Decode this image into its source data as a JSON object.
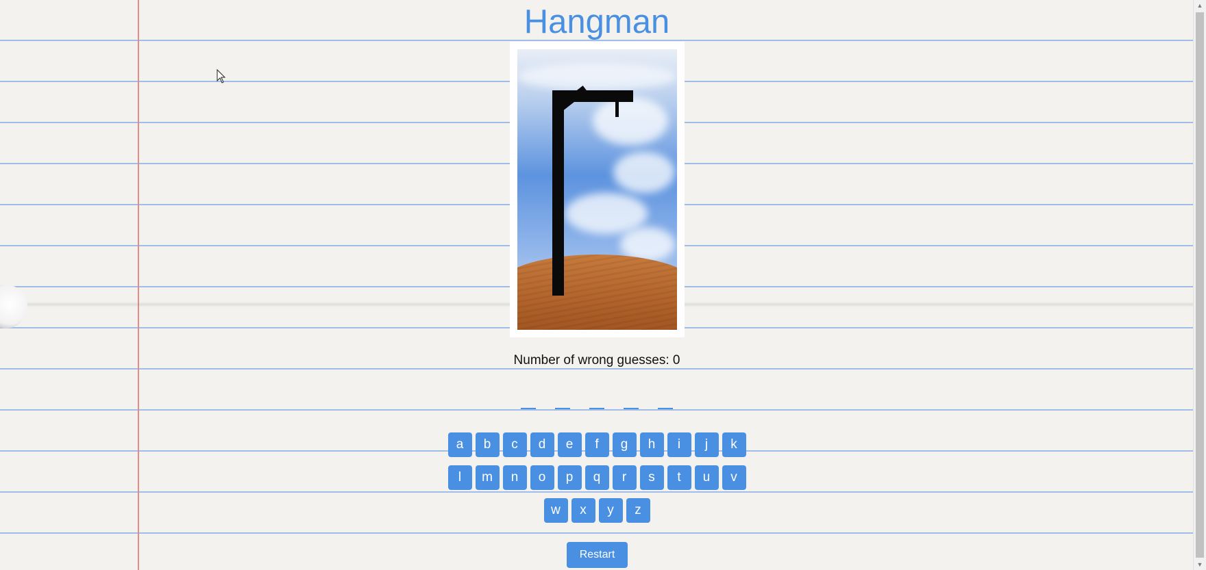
{
  "page": {
    "title": "Hangman"
  },
  "status": {
    "wrong_guesses_text": "Number of wrong guesses: 0",
    "wrong_guesses_count": 0
  },
  "word": {
    "length": 5,
    "revealed": [
      "",
      "",
      "",
      "",
      ""
    ]
  },
  "keyboard": {
    "rows": [
      [
        "a",
        "b",
        "c",
        "d",
        "e",
        "f",
        "g",
        "h",
        "i",
        "j",
        "k"
      ],
      [
        "l",
        "m",
        "n",
        "o",
        "p",
        "q",
        "r",
        "s",
        "t",
        "u",
        "v"
      ],
      [
        "w",
        "x",
        "y",
        "z"
      ]
    ]
  },
  "actions": {
    "restart_label": "Restart"
  },
  "icons": {
    "cursor": "mouse-pointer-icon",
    "scroll_up": "chevron-up-icon",
    "scroll_down": "chevron-down-icon"
  },
  "colors": {
    "accent": "#4a90e2",
    "button_text": "#ffffff",
    "gallows": "#0a0a0a"
  }
}
